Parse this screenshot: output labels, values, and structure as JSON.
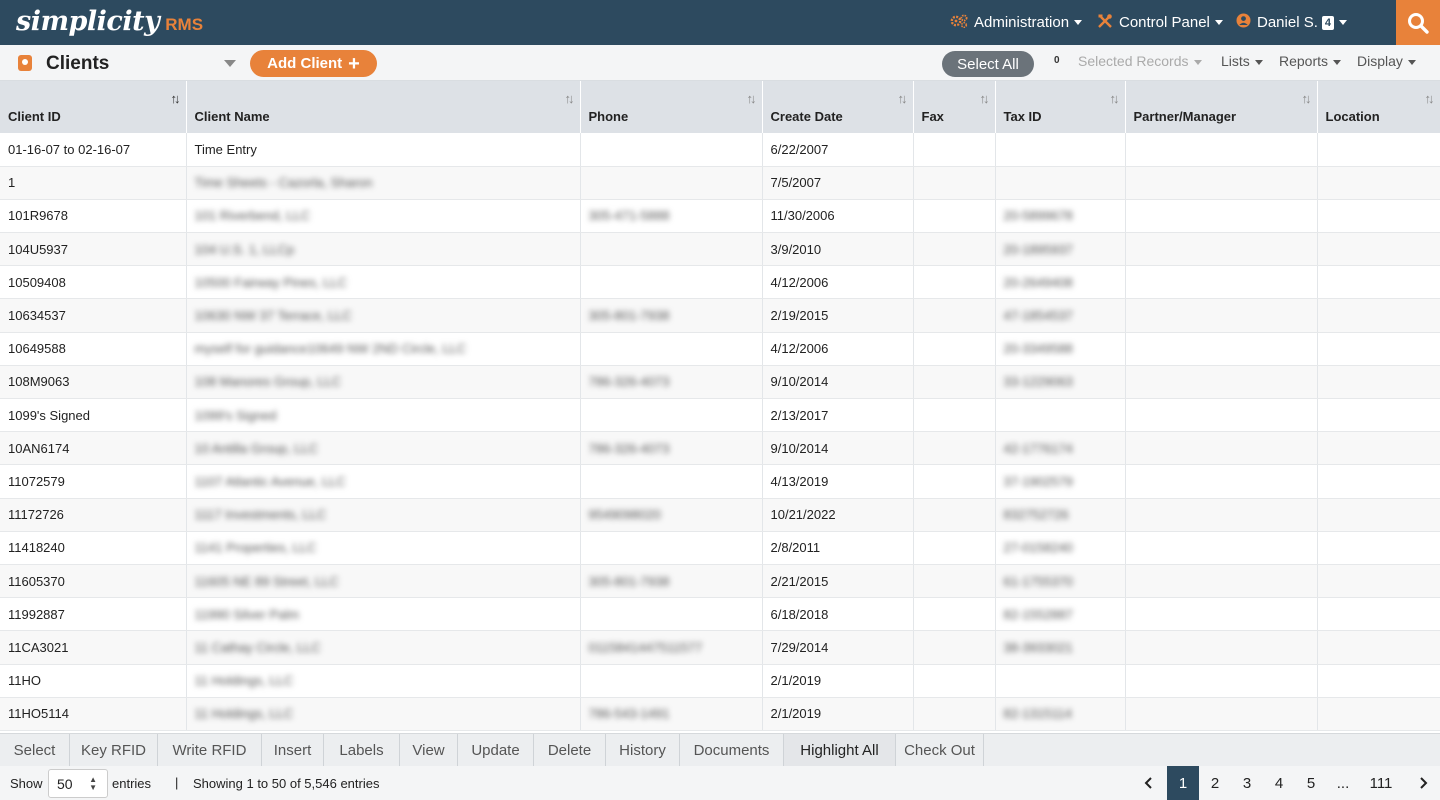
{
  "brand": {
    "name": "simplicity",
    "suffix": "RMS"
  },
  "nav": {
    "admin_label": "Administration",
    "control_label": "Control Panel",
    "user_label": "Daniel S.",
    "user_badge": "4"
  },
  "toolbar": {
    "title": "Clients",
    "add_label": "Add Client",
    "add_plus": "+",
    "select_all": "Select All",
    "selected_count": "0",
    "selected_records": "Selected Records",
    "lists": "Lists",
    "reports": "Reports",
    "display": "Display"
  },
  "table": {
    "columns": [
      "Client ID",
      "Client Name",
      "Phone",
      "Create Date",
      "Fax",
      "Tax ID",
      "Partner/Manager",
      "Location"
    ],
    "rows": [
      {
        "id": "01-16-07 to 02-16-07",
        "name": "Time Entry",
        "phone": "",
        "date": "6/22/2007",
        "fax": "",
        "tax": "",
        "partner": "",
        "loc": ""
      },
      {
        "id": "1",
        "name": "Time Sheets - Cazorla, Sharon",
        "phone": "",
        "date": "7/5/2007",
        "fax": "",
        "tax": "",
        "partner": "",
        "loc": ""
      },
      {
        "id": "101R9678",
        "name": "101 Riverbend, LLC",
        "phone": "305-471-5888",
        "date": "11/30/2006",
        "fax": "",
        "tax": "20-5899678",
        "partner": "",
        "loc": ""
      },
      {
        "id": "104U5937",
        "name": "104 U.S. 1, LLCp",
        "phone": "",
        "date": "3/9/2010",
        "fax": "",
        "tax": "20-1895937",
        "partner": "",
        "loc": ""
      },
      {
        "id": "10509408",
        "name": "10500 Fairway Pines, LLC",
        "phone": "",
        "date": "4/12/2006",
        "fax": "",
        "tax": "20-2649408",
        "partner": "",
        "loc": ""
      },
      {
        "id": "10634537",
        "name": "10630 NW 37 Terrace, LLC",
        "phone": "305-801-7938",
        "date": "2/19/2015",
        "fax": "",
        "tax": "47-1854537",
        "partner": "",
        "loc": ""
      },
      {
        "id": "10649588",
        "name": "myself for guidance10649 NW 2ND Circle, LLC",
        "phone": "",
        "date": "4/12/2006",
        "fax": "",
        "tax": "20-3349588",
        "partner": "",
        "loc": ""
      },
      {
        "id": "108M9063",
        "name": "108 Manores Group, LLC",
        "phone": "786-326-4073",
        "date": "9/10/2014",
        "fax": "",
        "tax": "33-1229063",
        "partner": "",
        "loc": ""
      },
      {
        "id": "1099's Signed",
        "name": "1099's Signed",
        "phone": "",
        "date": "2/13/2017",
        "fax": "",
        "tax": "",
        "partner": "",
        "loc": ""
      },
      {
        "id": "10AN6174",
        "name": "10 Antilla Group, LLC",
        "phone": "786-326-4073",
        "date": "9/10/2014",
        "fax": "",
        "tax": "42-1776174",
        "partner": "",
        "loc": ""
      },
      {
        "id": "11072579",
        "name": "1107 Atlantic Avenue, LLC",
        "phone": "",
        "date": "4/13/2019",
        "fax": "",
        "tax": "37-1902579",
        "partner": "",
        "loc": ""
      },
      {
        "id": "11172726",
        "name": "1117 Investments, LLC",
        "phone": "9549098020",
        "date": "10/21/2022",
        "fax": "",
        "tax": "832752726",
        "partner": "",
        "loc": ""
      },
      {
        "id": "11418240",
        "name": "1141 Properties, LLC",
        "phone": "",
        "date": "2/8/2011",
        "fax": "",
        "tax": "27-0158240",
        "partner": "",
        "loc": ""
      },
      {
        "id": "11605370",
        "name": "11605 NE 89 Street, LLC",
        "phone": "305-801-7938",
        "date": "2/21/2015",
        "fax": "",
        "tax": "61-1755370",
        "partner": "",
        "loc": ""
      },
      {
        "id": "11992887",
        "name": "11990 Silver Palm",
        "phone": "",
        "date": "6/18/2018",
        "fax": "",
        "tax": "82-1552887",
        "partner": "",
        "loc": ""
      },
      {
        "id": "11CA3021",
        "name": "11 Cathay Circle, LLC",
        "phone": "0115841447511577",
        "date": "7/29/2014",
        "fax": "",
        "tax": "38-3933021",
        "partner": "",
        "loc": ""
      },
      {
        "id": "11HO",
        "name": "11 Holdings, LLC",
        "phone": "",
        "date": "2/1/2019",
        "fax": "",
        "tax": "",
        "partner": "",
        "loc": ""
      },
      {
        "id": "11HO5114",
        "name": "11 Holdings, LLC",
        "phone": "786-543-1491",
        "date": "2/1/2019",
        "fax": "",
        "tax": "82-1315114",
        "partner": "",
        "loc": ""
      }
    ]
  },
  "actions": [
    "Select",
    "Key RFID",
    "Write RFID",
    "Insert",
    "Labels",
    "View",
    "Update",
    "Delete",
    "History",
    "Documents",
    "Highlight All",
    "Check Out"
  ],
  "footer": {
    "show": "Show",
    "page_size": "50",
    "entries": "entries",
    "separator": "|",
    "showing": "Showing 1 to 50 of 5,546 entries",
    "pages": [
      "1",
      "2",
      "3",
      "4",
      "5",
      "...",
      "111"
    ],
    "current_page": "1"
  },
  "colors": {
    "nav_bg": "#2d4a5f",
    "accent": "#e8823a"
  }
}
